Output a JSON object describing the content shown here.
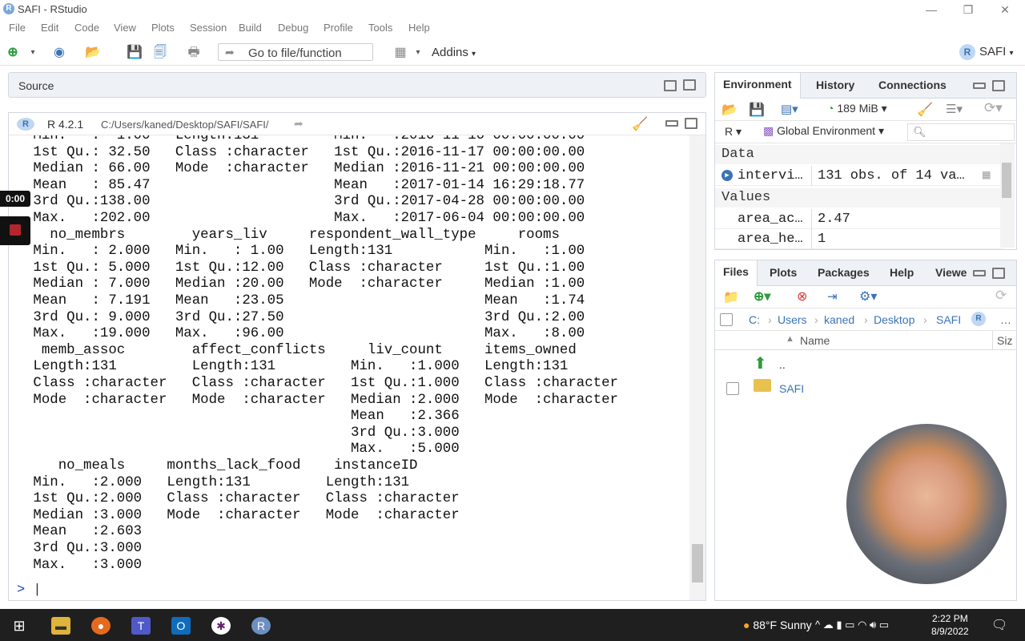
{
  "window": {
    "title": "SAFI - RStudio"
  },
  "menu": [
    "File",
    "Edit",
    "Code",
    "View",
    "Plots",
    "Session",
    "Build",
    "Debug",
    "Profile",
    "Tools",
    "Help"
  ],
  "toolbar": {
    "goto_label": "Go to file/function",
    "addins_label": "Addins",
    "project_label": "SAFI"
  },
  "source": {
    "label": "Source"
  },
  "console": {
    "r_version": "R 4.2.1",
    "path": "C:/Users/kaned/Desktop/SAFI/SAFI/",
    "prompt": ">",
    "lines": [
      " Min.   :  1.00   Length:131         Min.   :2016-11-16 00:00:00.00  ",
      " 1st Qu.: 32.50   Class :character   1st Qu.:2016-11-17 00:00:00.00  ",
      " Median : 66.00   Mode  :character   Median :2016-11-21 00:00:00.00  ",
      " Mean   : 85.47                      Mean   :2017-01-14 16:29:18.77  ",
      " 3rd Qu.:138.00                      3rd Qu.:2017-04-28 00:00:00.00  ",
      " Max.   :202.00                      Max.   :2017-06-04 00:00:00.00  ",
      "   no_membrs        years_liv     respondent_wall_type     rooms     ",
      " Min.   : 2.000   Min.   : 1.00   Length:131           Min.   :1.00  ",
      " 1st Qu.: 5.000   1st Qu.:12.00   Class :character     1st Qu.:1.00  ",
      " Median : 7.000   Median :20.00   Mode  :character     Median :1.00  ",
      " Mean   : 7.191   Mean   :23.05                        Mean   :1.74  ",
      " 3rd Qu.: 9.000   3rd Qu.:27.50                        3rd Qu.:2.00  ",
      " Max.   :19.000   Max.   :96.00                        Max.   :8.00  ",
      "  memb_assoc        affect_conflicts     liv_count     items_owned      ",
      " Length:131         Length:131         Min.   :1.000   Length:131         ",
      " Class :character   Class :character   1st Qu.:1.000   Class :character   ",
      " Mode  :character   Mode  :character   Median :2.000   Mode  :character   ",
      "                                       Mean   :2.366                      ",
      "                                       3rd Qu.:3.000                      ",
      "                                       Max.   :5.000                      ",
      "    no_meals     months_lack_food    instanceID       ",
      " Min.   :2.000   Length:131         Length:131        ",
      " 1st Qu.:2.000   Class :character   Class :character  ",
      " Median :3.000   Mode  :character   Mode  :character  ",
      " Mean   :2.603                                        ",
      " 3rd Qu.:3.000                                        ",
      " Max.   :3.000                                        "
    ]
  },
  "env": {
    "tabs": [
      "Environment",
      "History",
      "Connections"
    ],
    "memory": "189 MiB",
    "lang": "R",
    "scope": "Global Environment",
    "data_header": "Data",
    "values_header": "Values",
    "data_rows": [
      {
        "name": "intervi…",
        "value": "131 obs. of 14 va…"
      }
    ],
    "value_rows": [
      {
        "name": "area_ac…",
        "value": "2.47"
      },
      {
        "name": "area_he…",
        "value": "1"
      }
    ]
  },
  "files": {
    "tabs": [
      "Files",
      "Plots",
      "Packages",
      "Help",
      "Viewe"
    ],
    "crumbs": [
      "C:",
      "Users",
      "kaned",
      "Desktop",
      "SAFI"
    ],
    "col_name": "Name",
    "col_size": "Siz",
    "rows": [
      {
        "name": ".."
      },
      {
        "name": "SAFI"
      }
    ]
  },
  "recording": {
    "timer": "0:00"
  },
  "taskbar": {
    "weather": "88°F  Sunny",
    "time": "2:22 PM",
    "date": "8/9/2022"
  }
}
